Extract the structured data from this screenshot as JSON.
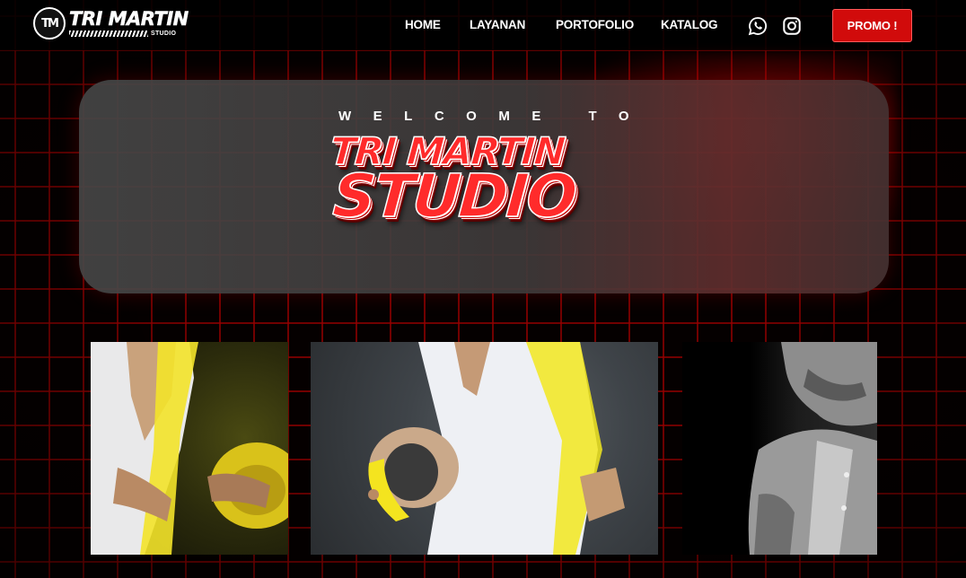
{
  "brand": {
    "mark": "TM",
    "name": "TRI MARTIN",
    "sub": "STUDIO"
  },
  "nav": {
    "items": [
      {
        "label": "HOME"
      },
      {
        "label": "LAYANAN"
      },
      {
        "label": "PORTOFOLIO"
      },
      {
        "label": "KATALOG"
      }
    ],
    "icons": [
      "whatsapp-icon",
      "instagram-icon"
    ],
    "promo_label": "PROMO !"
  },
  "hero": {
    "welcome": "WELCOME TO",
    "title_line1": "TRI MARTIN",
    "title_line2": "STUDIO"
  },
  "gallery": {
    "photos": [
      "photo-1",
      "photo-2",
      "photo-3"
    ]
  },
  "colors": {
    "accent": "#d10b0b",
    "grid": "#960000",
    "background": "#000000"
  }
}
